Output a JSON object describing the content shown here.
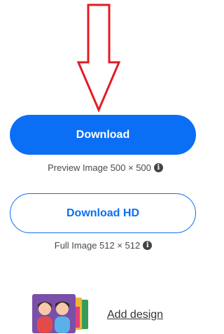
{
  "buttons": {
    "download_label": "Download",
    "download_hd_label": "Download HD"
  },
  "captions": {
    "preview": "Preview Image 500 × 500",
    "full": "Full Image 512 × 512"
  },
  "add_design": {
    "label": "Add design"
  },
  "colors": {
    "accent": "#0b6ff5",
    "arrow": "#e31b23"
  },
  "icons": {
    "info": "info-icon",
    "arrow": "down-arrow-annotation"
  }
}
